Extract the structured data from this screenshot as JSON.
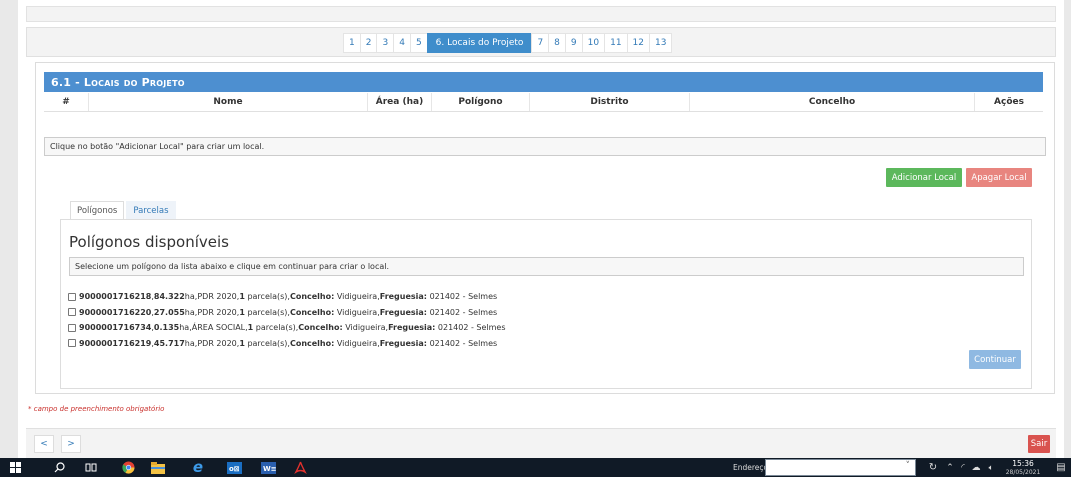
{
  "pager": {
    "pages": [
      "1",
      "2",
      "3",
      "4",
      "5",
      "6. Locais do Projeto",
      "7",
      "8",
      "9",
      "10",
      "11",
      "12",
      "13"
    ],
    "active_index": 5
  },
  "section": {
    "title": "6.1 - Locais do Projeto",
    "columns": [
      "#",
      "Nome",
      "Área (ha)",
      "Polígono",
      "Distrito",
      "Concelho",
      "Ações"
    ],
    "empty_message": "Clique no botão \"Adicionar Local\" para criar um local."
  },
  "actions": {
    "add_label": "Adicionar Local",
    "delete_label": "Apagar Local"
  },
  "tabs": {
    "items": [
      "Polígonos",
      "Parcelas"
    ],
    "active_index": 0
  },
  "poligonos": {
    "heading": "Polígonos disponíveis",
    "instruction": "Selecione um polígono da lista abaixo e clique em continuar para criar o local.",
    "items": [
      {
        "id": "9000001716218",
        "area": "84.322",
        "area_unit": "ha",
        "tipo": "PDR 2020",
        "parcelas": "1",
        "parcelas_suffix": "parcela(s)",
        "concelho_label": "Concelho:",
        "concelho": "Vidigueira",
        "freguesia_label": "Freguesia:",
        "freguesia": "021402 - Selmes",
        "sep": " , "
      },
      {
        "id": "9000001716220",
        "area": "27.055",
        "area_unit": "ha",
        "tipo": "PDR 2020",
        "parcelas": "1",
        "parcelas_suffix": "parcela(s)",
        "concelho_label": "Concelho:",
        "concelho": "Vidigueira",
        "freguesia_label": "Freguesia:",
        "freguesia": "021402 - Selmes",
        "sep": " , "
      },
      {
        "id": "9000001716734",
        "area": "0.135",
        "area_unit": "ha",
        "tipo": "ÁREA SOCIAL",
        "parcelas": "1",
        "parcelas_suffix": "parcela(s)",
        "concelho_label": "Concelho:",
        "concelho": "Vidigueira",
        "freguesia_label": "Freguesia:",
        "freguesia": "021402 - Selmes",
        "sep": " , "
      },
      {
        "id": "9000001716219",
        "area": "45.717",
        "area_unit": "ha",
        "tipo": "PDR 2020",
        "parcelas": "1",
        "parcelas_suffix": "parcela(s)",
        "concelho_label": "Concelho:",
        "concelho": "Vidigueira",
        "freguesia_label": "Freguesia:",
        "freguesia": "021402 - Selmes",
        "sep": " , "
      }
    ],
    "continue_label": "Continuar"
  },
  "footer": {
    "required_note": "* campo de preenchimento obrigatório",
    "prev_label": "<",
    "next_label": ">",
    "exit_label": "Sair"
  },
  "taskbar": {
    "address_label": "Endereço",
    "time": "15:36",
    "date": "28/05/2021",
    "icons": [
      "windows-start-icon",
      "search-icon",
      "task-view-icon",
      "chrome-icon",
      "file-explorer-icon",
      "internet-explorer-icon",
      "outlook-icon",
      "word-icon",
      "acrobat-icon",
      "refresh-icon",
      "tray-chevron-icon",
      "wifi-icon",
      "cloud-icon",
      "volume-icon",
      "notification-icon"
    ]
  },
  "colors": {
    "header_blue": "#4d8fd0",
    "add_green": "#5cb85c",
    "delete_red": "#e8857f",
    "exit_red": "#d9534f",
    "continue_blue": "#8fb9e2"
  }
}
